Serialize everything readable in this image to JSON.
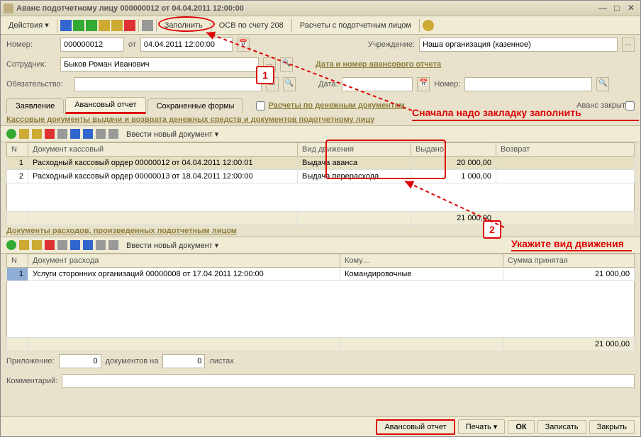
{
  "window": {
    "title": "Аванс подотчетному лицу 000000012 от 04.04.2011 12:00:00"
  },
  "toolbar": {
    "actions": "Действия",
    "fill": "Заполнить",
    "osv": "ОСВ по счету 208",
    "calc": "Расчеты с подотчетным лицом"
  },
  "form": {
    "number_label": "Номер:",
    "number": "000000012",
    "from_label": "от",
    "date": "04.04.2011 12:00:00",
    "org_label": "Учреждение:",
    "org": "Наша организация (казенное)",
    "employee_label": "Сотрудник:",
    "employee": "Быков Роман Иванович",
    "report_hdr": "Дата и номер авансового отчета",
    "obligation_label": "Обязательство:",
    "date_label": "Дата:",
    "num_label": "Номер:",
    "closed_label": "Аванс закрыт"
  },
  "tabs": {
    "t1": "Заявление",
    "t2": "Авансовый отчет",
    "t3": "Сохраненные формы",
    "cash_docs": "Расчеты по денежным документам"
  },
  "section1": {
    "title": "Кассовые документы выдачи и возврата денежных средств и документов подотчетному лицу",
    "new_doc": "Ввести новый документ",
    "cols": {
      "n": "N",
      "doc": "Документ кассовый",
      "type": "Вид движения",
      "issued": "Выдано",
      "returned": "Возврат"
    },
    "rows": [
      {
        "n": "1",
        "doc": "Расходный кассовый ордер 00000012 от 04.04.2011 12:00:01",
        "type": "Выдача аванса",
        "issued": "20 000,00",
        "returned": ""
      },
      {
        "n": "2",
        "doc": "Расходный кассовый ордер 00000013 от 18.04.2011 12:00:00",
        "type": "Выдача перерасхода",
        "issued": "1 000,00",
        "returned": ""
      }
    ],
    "total_issued": "21 000,00"
  },
  "section2": {
    "title": "Документы расходов, произведенных подотчетным лицом",
    "new_doc": "Ввести новый документ",
    "cols": {
      "n": "N",
      "doc": "Документ расхода",
      "whom": "Кому…",
      "sum": "Сумма принятая"
    },
    "rows": [
      {
        "n": "1",
        "doc": "Услуги сторонних организаций 00000008 от 17.04.2011 12:00:00",
        "whom": "Командировочные",
        "sum": "21 000,00"
      }
    ],
    "total": "21 000,00"
  },
  "footer": {
    "attach_label": "Приложение:",
    "attach_val": "0",
    "docs_on": "документов на",
    "sheets_val": "0",
    "sheets": "листах",
    "comment_label": "Комментарий:"
  },
  "bottom": {
    "report": "Авансовый отчет",
    "print": "Печать",
    "ok": "ОК",
    "save": "Записать",
    "close": "Закрыть"
  },
  "annotations": {
    "a1": "1",
    "a2": "2",
    "text1": "Сначала надо закладку заполнить",
    "text2": "Укажите вид движения"
  }
}
